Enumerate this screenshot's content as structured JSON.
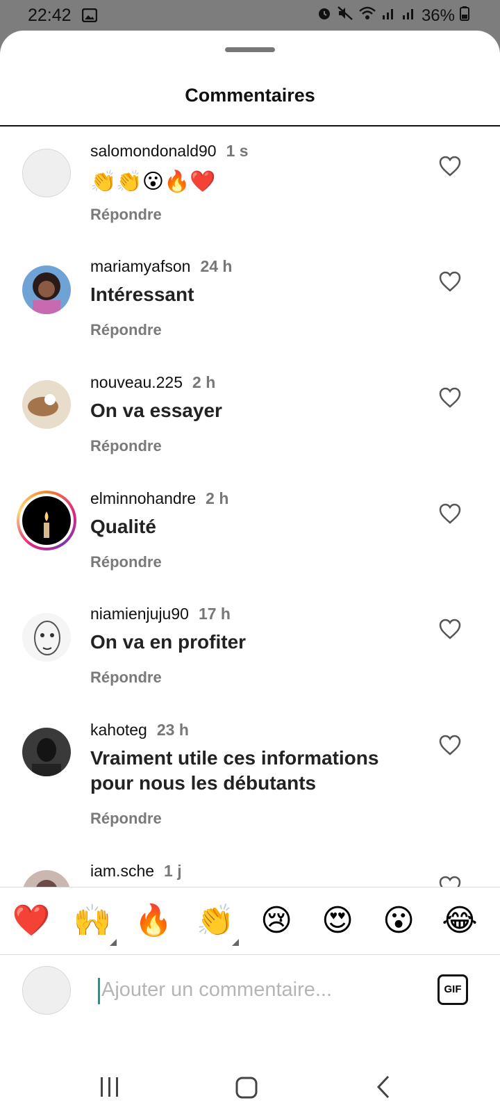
{
  "status_bar": {
    "time": "22:42",
    "battery": "36%"
  },
  "header": {
    "title": "Commentaires"
  },
  "comments": [
    {
      "username": "salomondonald90",
      "time": "1 s",
      "text": "👏👏😮🔥❤️",
      "reply": "Répondre"
    },
    {
      "username": "mariamyafson",
      "time": "24 h",
      "text": "Intéressant",
      "reply": "Répondre"
    },
    {
      "username": "nouveau.225",
      "time": "2 h",
      "text": "On va essayer",
      "reply": "Répondre"
    },
    {
      "username": "elminnohandre",
      "time": "2 h",
      "text": "Qualité",
      "reply": "Répondre"
    },
    {
      "username": "niamienjuju90",
      "time": "17 h",
      "text": "On va en profiter",
      "reply": "Répondre"
    },
    {
      "username": "kahoteg",
      "time": "23 h",
      "text_line1": "Vraiment utile ces informations",
      "text_line2": "pour nous les débutants",
      "reply": "Répondre"
    },
    {
      "username": "iam.sche",
      "time": "1 j"
    }
  ],
  "reactions": [
    "❤️",
    "🙌",
    "🔥",
    "👏",
    "😢",
    "😍",
    "😮",
    "😂"
  ],
  "composer": {
    "placeholder": "Ajouter un commentaire...",
    "gif_label": "GIF"
  },
  "icons": {
    "heart": "heart-outline-icon",
    "gif": "gif-icon",
    "recents": "recents-icon",
    "home": "home-icon",
    "back": "back-icon"
  }
}
